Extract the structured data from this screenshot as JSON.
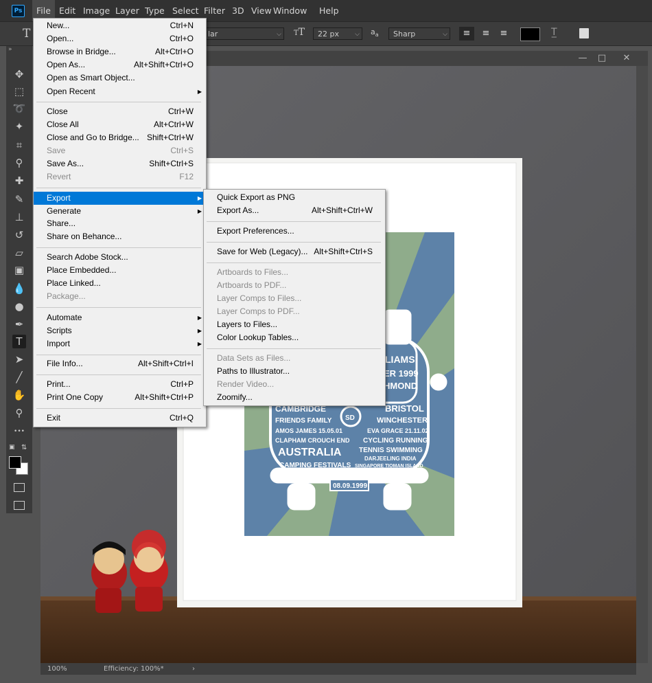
{
  "app": {
    "logo": "Ps"
  },
  "menubar": [
    "File",
    "Edit",
    "Image",
    "Layer",
    "Type",
    "Select",
    "Filter",
    "3D",
    "View",
    "Window",
    "Help"
  ],
  "options": {
    "font_style": "lar",
    "font_size": "22 px",
    "antialias": "Sharp",
    "size_icon": "font-size-icon",
    "aa_icon": "anti-alias-icon"
  },
  "status": {
    "zoom": "100%",
    "efficiency": "Efficiency: 100%*",
    "arrow": "›"
  },
  "file_menu": [
    {
      "label": "New...",
      "shortcut": "Ctrl+N"
    },
    {
      "label": "Open...",
      "shortcut": "Ctrl+O"
    },
    {
      "label": "Browse in Bridge...",
      "shortcut": "Alt+Ctrl+O"
    },
    {
      "label": "Open As...",
      "shortcut": "Alt+Shift+Ctrl+O"
    },
    {
      "label": "Open as Smart Object...",
      "shortcut": ""
    },
    {
      "label": "Open Recent",
      "shortcut": "",
      "submenu": true
    },
    {
      "label": "Close",
      "shortcut": "Ctrl+W"
    },
    {
      "label": "Close All",
      "shortcut": "Alt+Ctrl+W"
    },
    {
      "label": "Close and Go to Bridge...",
      "shortcut": "Shift+Ctrl+W"
    },
    {
      "label": "Save",
      "shortcut": "Ctrl+S",
      "disabled": true
    },
    {
      "label": "Save As...",
      "shortcut": "Shift+Ctrl+S"
    },
    {
      "label": "Revert",
      "shortcut": "F12",
      "disabled": true
    },
    {
      "label": "Export",
      "shortcut": "",
      "submenu": true,
      "highlighted": true
    },
    {
      "label": "Generate",
      "shortcut": "",
      "submenu": true
    },
    {
      "label": "Share...",
      "shortcut": ""
    },
    {
      "label": "Share on Behance...",
      "shortcut": ""
    },
    {
      "label": "Search Adobe Stock...",
      "shortcut": ""
    },
    {
      "label": "Place Embedded...",
      "shortcut": ""
    },
    {
      "label": "Place Linked...",
      "shortcut": ""
    },
    {
      "label": "Package...",
      "shortcut": "",
      "disabled": true
    },
    {
      "label": "Automate",
      "shortcut": "",
      "submenu": true
    },
    {
      "label": "Scripts",
      "shortcut": "",
      "submenu": true
    },
    {
      "label": "Import",
      "shortcut": "",
      "submenu": true
    },
    {
      "label": "File Info...",
      "shortcut": "Alt+Shift+Ctrl+I"
    },
    {
      "label": "Print...",
      "shortcut": "Ctrl+P"
    },
    {
      "label": "Print One Copy",
      "shortcut": "Alt+Shift+Ctrl+P"
    },
    {
      "label": "Exit",
      "shortcut": "Ctrl+Q"
    }
  ],
  "export_menu": [
    {
      "label": "Quick Export as PNG",
      "shortcut": ""
    },
    {
      "label": "Export As...",
      "shortcut": "Alt+Shift+Ctrl+W"
    },
    {
      "label": "Export Preferences...",
      "shortcut": ""
    },
    {
      "label": "Save for Web (Legacy)...",
      "shortcut": "Alt+Shift+Ctrl+S"
    },
    {
      "label": "Artboards to Files...",
      "shortcut": "",
      "disabled": true
    },
    {
      "label": "Artboards to PDF...",
      "shortcut": "",
      "disabled": true
    },
    {
      "label": "Layer Comps to Files...",
      "shortcut": "",
      "disabled": true
    },
    {
      "label": "Layer Comps to PDF...",
      "shortcut": "",
      "disabled": true
    },
    {
      "label": "Layers to Files...",
      "shortcut": ""
    },
    {
      "label": "Color Lookup Tables...",
      "shortcut": ""
    },
    {
      "label": "Data Sets as Files...",
      "shortcut": "",
      "disabled": true
    },
    {
      "label": "Paths to Illustrator...",
      "shortcut": ""
    },
    {
      "label": "Render Video...",
      "shortcut": "",
      "disabled": true
    },
    {
      "label": "Zoomify...",
      "shortcut": ""
    }
  ],
  "artwork": {
    "words_left": [
      "CAMBRIDGE",
      "FRIENDS FAMILY",
      "AMOS JAMES 15.05.01",
      "CLAPHAM CROUCH END",
      "AUSTRALIA",
      "CAMPING FESTIVALS"
    ],
    "words_right": [
      "BRISTOL",
      "WINCHESTER",
      "EVA GRACE 21.11.02",
      "CYCLING RUNNING",
      "TENNIS SWIMMING",
      "DARJEELING INDIA",
      "SINGAPORE TIOMAN ISLAND"
    ],
    "words_top": [
      "LIAMS",
      "ER 1999",
      "HMOND"
    ],
    "badge": "SD",
    "plate": "08.09.1999"
  },
  "colors": {
    "accent": "#0078d7",
    "menu_bg": "#f0f0f0",
    "poster_blue": "#5d82a8",
    "poster_green": "#8fac8b"
  }
}
